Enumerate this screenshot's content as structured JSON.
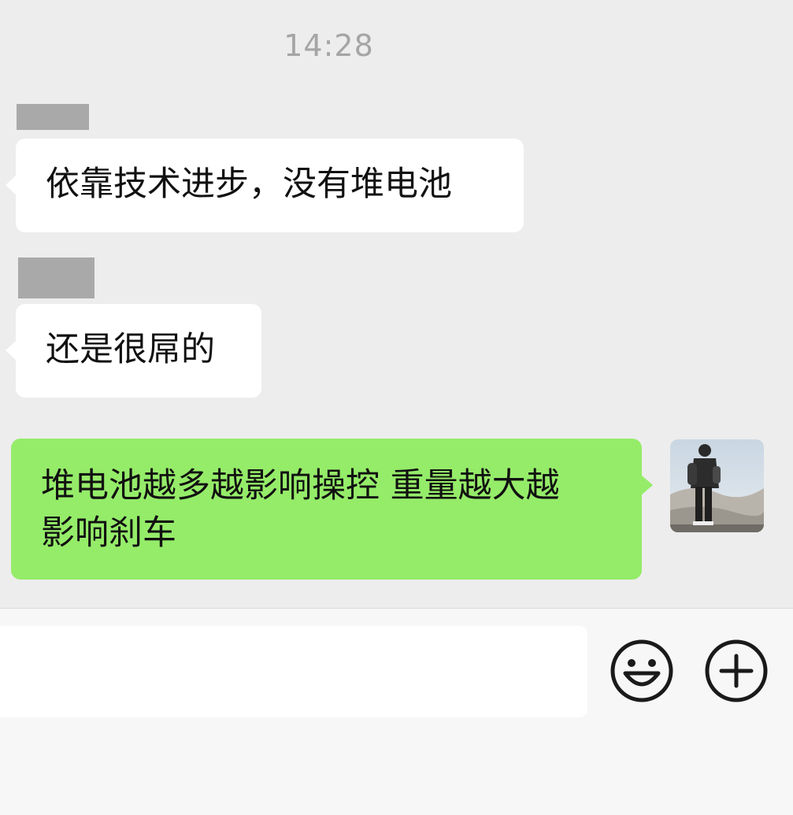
{
  "timestamp": "14:28",
  "messages": [
    {
      "direction": "incoming",
      "text": "依靠技术进步，没有堆电池"
    },
    {
      "direction": "incoming",
      "text": "还是很屌的"
    },
    {
      "direction": "outgoing",
      "line1": "堆电池越多越影响操控 重量越大越",
      "line2": "影响刹车"
    }
  ],
  "input_bar": {
    "placeholder": "",
    "emoji_icon": "emoji-smile-icon",
    "more_icon": "plus-circle-icon"
  },
  "colors": {
    "chat_background": "#ededed",
    "incoming_bubble": "#ffffff",
    "outgoing_bubble": "#95ec69",
    "timestamp_text": "#a5a5a5"
  }
}
